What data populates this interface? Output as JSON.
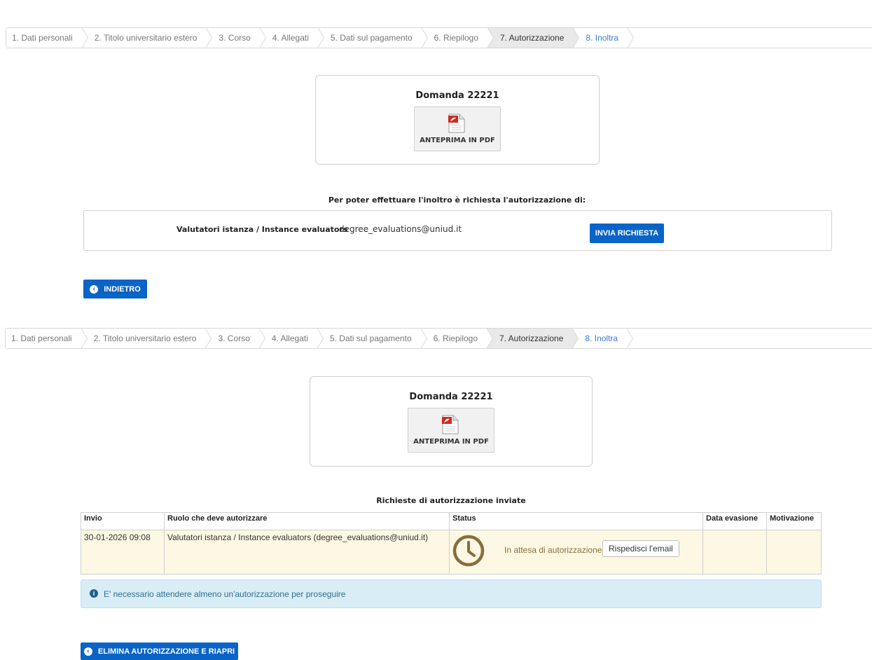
{
  "steps": [
    {
      "label": "1. Dati personali"
    },
    {
      "label": "2. Titolo universitario estero"
    },
    {
      "label": "3. Corso"
    },
    {
      "label": "4. Allegati"
    },
    {
      "label": "5. Dati sul pagamento"
    },
    {
      "label": "6. Riepilogo"
    },
    {
      "label": "7. Autorizzazione"
    },
    {
      "label": "8. Inoltra"
    }
  ],
  "application": {
    "title": "Domanda 22221",
    "pdf_label": "ANTEPRIMA IN PDF",
    "pdf_icon": "pdf-file-icon"
  },
  "before": {
    "notice": "Per poter effettuare l'inoltro è richiesta l'autorizzazione di:",
    "evaluator_role": "Valutatori istanza / Instance evaluators",
    "evaluator_email": "degree_evaluations@uniud.it",
    "send_request": "INVIA RICHIESTA",
    "back": "INDIETRO"
  },
  "after": {
    "table_title": "Richieste di autorizzazione inviate",
    "columns": {
      "sent": "Invio",
      "role": "Ruolo che deve autorizzare",
      "status": "Status",
      "date_done": "Data evasione",
      "reason": "Motivazione"
    },
    "row": {
      "sent": "30-01-2026 09:08",
      "role": "Valutatori istanza / Instance evaluators (degree_evaluations@uniud.it)",
      "status": "In attesa di autorizzazione",
      "resend": "Rispedisci l'email",
      "date_done": "",
      "reason": ""
    },
    "info": "E' necessario attendere almeno un'autorizzazione per proseguire",
    "delete_reopen": "ELIMINA AUTORIZZAZIONE E RIAPRI"
  },
  "colors": {
    "primary": "#0a64c8",
    "pending_row": "#fcf8e3",
    "pending_text": "#8a6d3b",
    "info_bg": "#d9edf7"
  }
}
